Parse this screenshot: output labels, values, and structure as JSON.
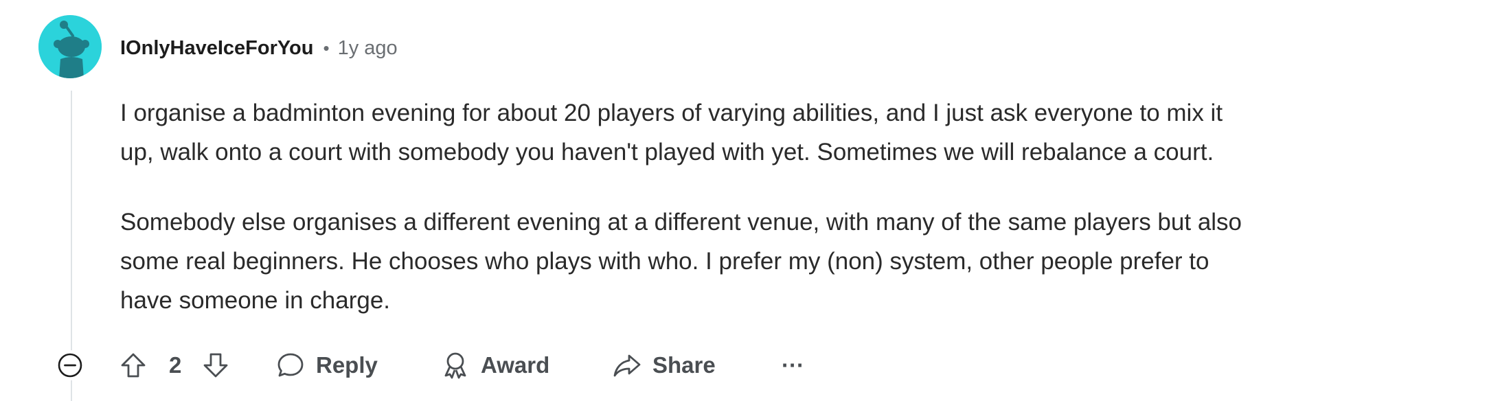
{
  "comment": {
    "username": "IOnlyHaveIceForYou",
    "separator": "•",
    "timestamp": "1y ago",
    "paragraphs": [
      "I organise a badminton evening for about 20 players of varying abilities, and I just ask everyone to mix it\nup, walk onto a court with somebody you haven't played with yet. Sometimes we will rebalance a court.",
      "Somebody else organises a different evening at a different venue, with many of the same players but also\nsome real beginners. He chooses who plays with who. I prefer my (non) system, other people prefer to\nhave someone in charge."
    ]
  },
  "actions": {
    "score": "2",
    "reply_label": "Reply",
    "award_label": "Award",
    "share_label": "Share",
    "more_label": "···"
  },
  "icons": {
    "avatar": "snoo-avatar-icon",
    "collapse": "collapse-minus-icon",
    "upvote": "upvote-arrow-icon",
    "downvote": "downvote-arrow-icon",
    "reply": "speech-bubble-icon",
    "award": "award-ribbon-icon",
    "share": "share-arrow-icon"
  },
  "colors": {
    "avatar_bg": "#2bd3db",
    "text": "#2a2a2a",
    "muted": "#6a6e72",
    "thread_line": "#dfe3e6"
  }
}
